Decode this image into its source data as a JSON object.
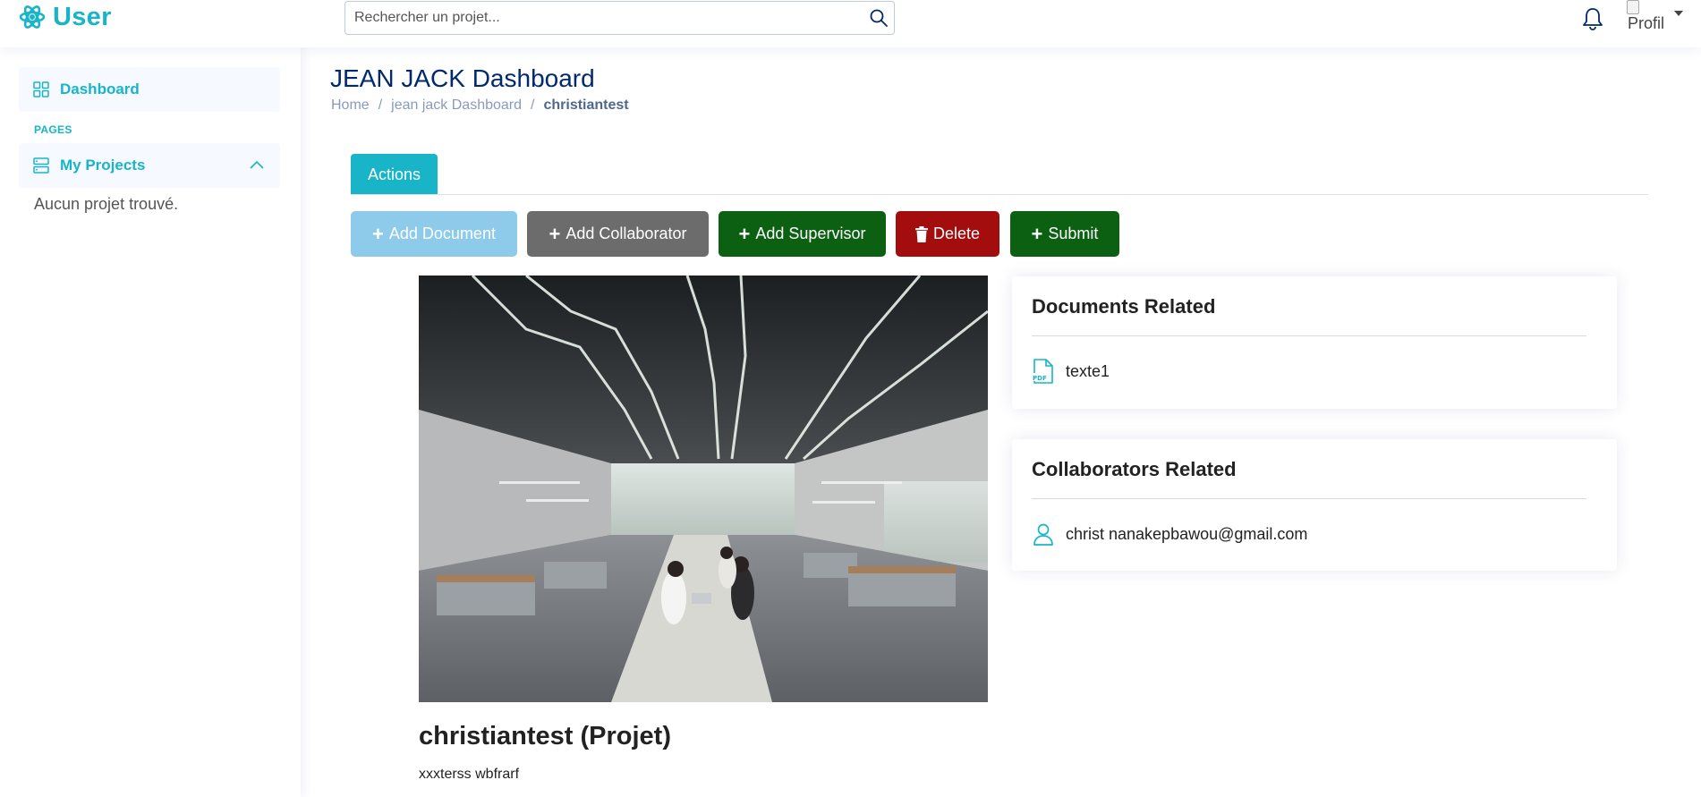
{
  "header": {
    "brand": "User",
    "search_placeholder": "Rechercher un projet...",
    "profile_alt": "Profil"
  },
  "sidebar": {
    "dashboard_label": "Dashboard",
    "section_heading": "PAGES",
    "projects_label": "My Projects",
    "empty_message": "Aucun projet trouvé."
  },
  "main": {
    "title": "JEAN JACK Dashboard",
    "breadcrumb": [
      "Home",
      "jean jack Dashboard",
      "christiantest"
    ],
    "tab_label": "Actions",
    "buttons": {
      "add_document": "Add Document",
      "add_collaborator": "Add Collaborator",
      "add_supervisor": "Add Supervisor",
      "delete": "Delete",
      "submit": "Submit"
    },
    "project": {
      "title": "christiantest (Projet)",
      "description": "xxxterss wbfrarf"
    },
    "documents": {
      "title": "Documents Related",
      "items": [
        {
          "icon": "pdf-file-icon",
          "name": "texte1"
        }
      ]
    },
    "collaborators": {
      "title": "Collaborators Related",
      "items": [
        {
          "icon": "person-icon",
          "name": "christ nanakepbawou@gmail.com"
        }
      ]
    }
  },
  "colors": {
    "accent": "#17b5c7",
    "title_navy": "#012970",
    "btn_light_blue": "#8ecbea",
    "btn_gray": "#6c6c6c",
    "btn_green": "#0b6012",
    "btn_red": "#a30d0d"
  }
}
